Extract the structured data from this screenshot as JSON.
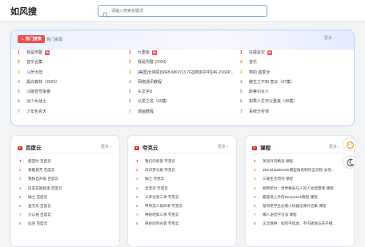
{
  "header": {
    "logo": "如风搜",
    "search_placeholder": "请输入搜索关键词"
  },
  "hot": {
    "badge": "热门搜索",
    "tab": "热门资源",
    "more": "更多",
    "columns": [
      [
        {
          "num": "1",
          "text": "我是刑警",
          "new": true
        },
        {
          "num": "2",
          "text": "音乐合集",
          "new": false
        },
        {
          "num": "3",
          "text": "斗罗大陆",
          "new": false
        },
        {
          "num": "4",
          "text": "黑白森林（2024）",
          "new": false
        },
        {
          "num": "5",
          "text": "斗破苍穹争番",
          "new": false
        },
        {
          "num": "6",
          "text": "淡少女战士",
          "new": false
        },
        {
          "num": "7",
          "text": "少年包青天",
          "new": false
        }
      ],
      [
        {
          "num": "1",
          "text": "九重紫",
          "new": true
        },
        {
          "num": "2",
          "text": "我是刑警 (2024)",
          "new": false
        },
        {
          "num": "3",
          "text": "[美国]长相思[WEB-MKV/13.7G][简体中字][4K-2160P...",
          "new": false
        },
        {
          "num": "4",
          "text": "网络通讯教程",
          "new": false
        },
        {
          "num": "5",
          "text": "头文字d",
          "new": false
        },
        {
          "num": "6",
          "text": "以爱之名（60集）",
          "new": false
        },
        {
          "num": "7",
          "text": "漫画教程",
          "new": false
        }
      ],
      [
        {
          "num": "1",
          "text": "在碰星空",
          "new": true
        },
        {
          "num": "2",
          "text": "音乐",
          "new": false
        },
        {
          "num": "3",
          "text": "燕的 首季全",
          "new": false
        },
        {
          "num": "4",
          "text": "傲生之不知 意云（47集）",
          "new": false
        },
        {
          "num": "5",
          "text": "斯蒂识女人",
          "new": false
        },
        {
          "num": "6",
          "text": "如果人生可以重来（49集）",
          "new": false
        },
        {
          "num": "7",
          "text": "系统分析师",
          "new": false
        }
      ]
    ]
  },
  "cards": [
    {
      "title": "百度云",
      "more": "更多",
      "items": [
        {
          "num": "1",
          "text": "鹿回时 百度云"
        },
        {
          "num": "2",
          "text": "春暖蔷芳 百度云"
        },
        {
          "num": "3",
          "text": "我独自升级 百度云"
        },
        {
          "num": "4",
          "text": "白莲花屋捉鬼 百度云"
        },
        {
          "num": "5",
          "text": "姊士 百度云"
        },
        {
          "num": "6",
          "text": "金无双 百度云"
        },
        {
          "num": "7",
          "text": "沙以雀 百度云"
        },
        {
          "num": "8",
          "text": "仙逆 百度云"
        }
      ]
    },
    {
      "title": "夸克云",
      "more": "更多",
      "items": [
        {
          "num": "1",
          "text": "我们的爸爸 夸克云"
        },
        {
          "num": "2",
          "text": "白日梦与她 夸克云"
        },
        {
          "num": "3",
          "text": "姊士 夸克云"
        },
        {
          "num": "4",
          "text": "念无双 夸克云"
        },
        {
          "num": "5",
          "text": "斗罗社第三季 夸克云"
        },
        {
          "num": "6",
          "text": "甲骨恋人第四季 夸克云"
        },
        {
          "num": "7",
          "text": "种地吧第三季 夸克云"
        },
        {
          "num": "8",
          "text": "奇妙的时光客 夸克云"
        }
      ]
    },
    {
      "title": "课程",
      "more": "更多",
      "items": [
        {
          "num": "1",
          "text": "英语外刊精读 课程"
        },
        {
          "num": "2",
          "text": "ZBrush&Blender模型角色制作全流程-女性..."
        },
        {
          "num": "3",
          "text": "三联生活周刊 课程"
        },
        {
          "num": "4",
          "text": "频势所为：世界格局与人的人生智慧课 课程"
        },
        {
          "num": "5",
          "text": "最容易上手的DeepSeek教程 课程"
        },
        {
          "num": "6",
          "text": "基哥老学生必看小机器记课外合集 课程"
        },
        {
          "num": "7",
          "text": "懒人语音学习法 课程"
        },
        {
          "num": "8",
          "text": "正念教养：如何不焦虑、不内耗地与孩子相..."
        }
      ]
    }
  ],
  "colors": {
    "accent": "#e02e24",
    "rank2": "#f57b20",
    "rank3": "#e8a317",
    "border": "#bcd3f5"
  }
}
